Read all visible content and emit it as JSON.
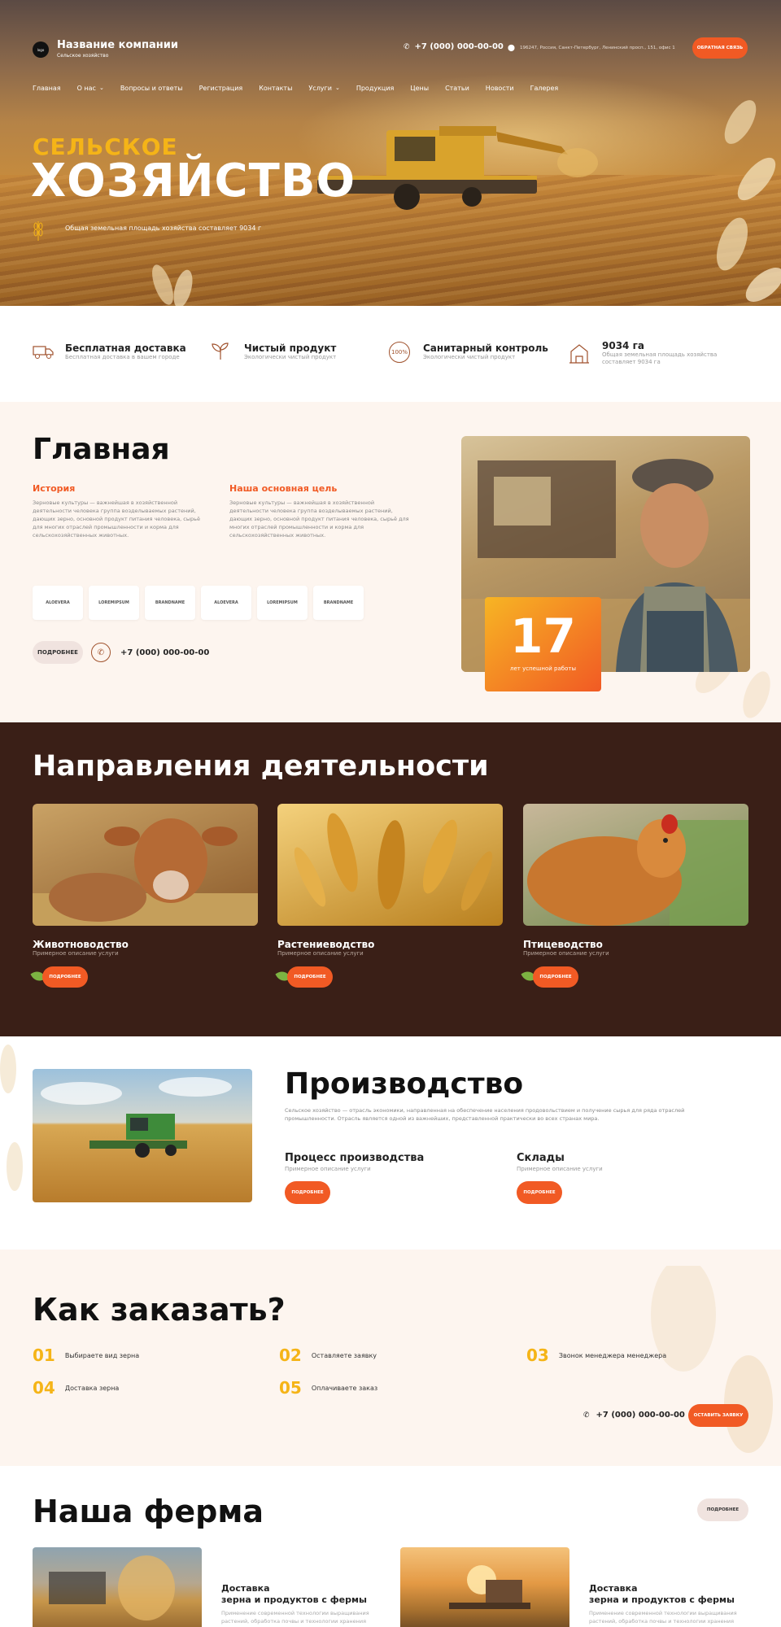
{
  "header": {
    "logo_text": "logo",
    "company_name": "Название компании",
    "company_sub": "Сельское хозяйство",
    "phone": "+7 (000) 000-00-00",
    "address": "196247, Россия, Санкт-Петербург, Ленинский просп., 151, офис 1",
    "callback_label": "Обратная связь"
  },
  "nav": [
    "Главная",
    "О нас",
    "Вопросы и ответы",
    "Регистрация",
    "Контакты",
    "Услуги",
    "Продукция",
    "Цены",
    "Статьи",
    "Новости",
    "Галерея"
  ],
  "hero": {
    "title_top": "СЕЛЬСКОЕ",
    "title_bottom": "ХОЗЯЙСТВО",
    "caption": "Общая земельная площадь хозяйства составляет 9034 г"
  },
  "features": [
    {
      "title": "Бесплатная доставка",
      "sub": "Бесплатная доставка в вашем городе",
      "icon": "truck-icon"
    },
    {
      "title": "Чистый продукт",
      "sub": "Экологически чистый продукт",
      "icon": "sprout-icon"
    },
    {
      "title": "Санитарный контроль",
      "sub": "Экологически чистый продукт",
      "icon": "badge-100-icon"
    },
    {
      "title": "9034 га",
      "sub": "Общая земельная площадь хозяйства составляет 9034 га",
      "icon": "farm-icon"
    }
  ],
  "about": {
    "title": "Главная",
    "col1_title": "История",
    "col1_text": "Зерновые культуры — важнейшая в хозяйственной деятельности человека группа возделываемых растений, дающих зерно, основной продукт питания человека, сырьё для многих отраслей промышленности и корма для сельскохозяйственных животных.",
    "col2_title": "Наша основная цель",
    "col2_text": "Зерновые культуры — важнейшая в хозяйственной деятельности человека группа возделываемых растений, дающих зерно, основной продукт питания человека, сырьё для многих отраслей промышленности и корма для сельскохозяйственных животных.",
    "logos": [
      "ALOEVERA",
      "LOREMIPSUM",
      "BRANDNAME",
      "ALOEVERA",
      "LOREMIPSUM",
      "BRANDNAME"
    ],
    "more_label": "Подробнее",
    "phone": "+7 (000) 000-00-00",
    "years_num": "17",
    "years_text": "лет успешной работы"
  },
  "directions": {
    "title": "Направления деятельности",
    "items": [
      {
        "title": "Животноводство",
        "sub": "Примерное описание услуги",
        "btn": "Подробнее"
      },
      {
        "title": "Растениеводство",
        "sub": "Примерное описание услуги",
        "btn": "Подробнее"
      },
      {
        "title": "Птицеводство",
        "sub": "Примерное описание услуги",
        "btn": "Подробнее"
      }
    ]
  },
  "production": {
    "title": "Производство",
    "text": "Сельское хозяйство — отрасль экономики, направленная на обеспечение населения продовольствием и получение сырья для ряда отраслей промышленности. Отрасль является одной из важнейших, представленной практически во всех странах мира.",
    "items": [
      {
        "title": "Процесс производства",
        "sub": "Примерное описание услуги",
        "btn": "Подробнее"
      },
      {
        "title": "Склады",
        "sub": "Примерное описание услуги",
        "btn": "Подробнее"
      }
    ]
  },
  "order": {
    "title": "Как заказать?",
    "steps": [
      {
        "num": "01",
        "text": "Выбираете вид зерна"
      },
      {
        "num": "02",
        "text": "Оставляете заявку"
      },
      {
        "num": "03",
        "text": "Звонок менеджера менеджера"
      },
      {
        "num": "04",
        "text": "Доставка зерна"
      },
      {
        "num": "05",
        "text": "Оплачиваете заказ"
      }
    ],
    "phone": "+7 (000) 000-00-00",
    "btn": "Оставить заявку"
  },
  "farm": {
    "title": "Наша ферма",
    "more_label": "Подробнее",
    "cards": [
      {
        "title_l1": "Доставка",
        "title_l2": "зерна и продуктов с фермы",
        "text": "Применение современной технологии выращивания растений, обработка почвы и технологии хранения зерна, а также"
      },
      {
        "title_l1": "Доставка",
        "title_l2": "зерна и продуктов с фермы",
        "text": "Применение современной технологии выращивания растений, обработка почвы и технологии хранения зерна, а также"
      }
    ]
  },
  "colors": {
    "accent": "#f15a24",
    "gold": "#f5b417",
    "brown": "#3a1f17",
    "cream": "#fdf5ef"
  }
}
